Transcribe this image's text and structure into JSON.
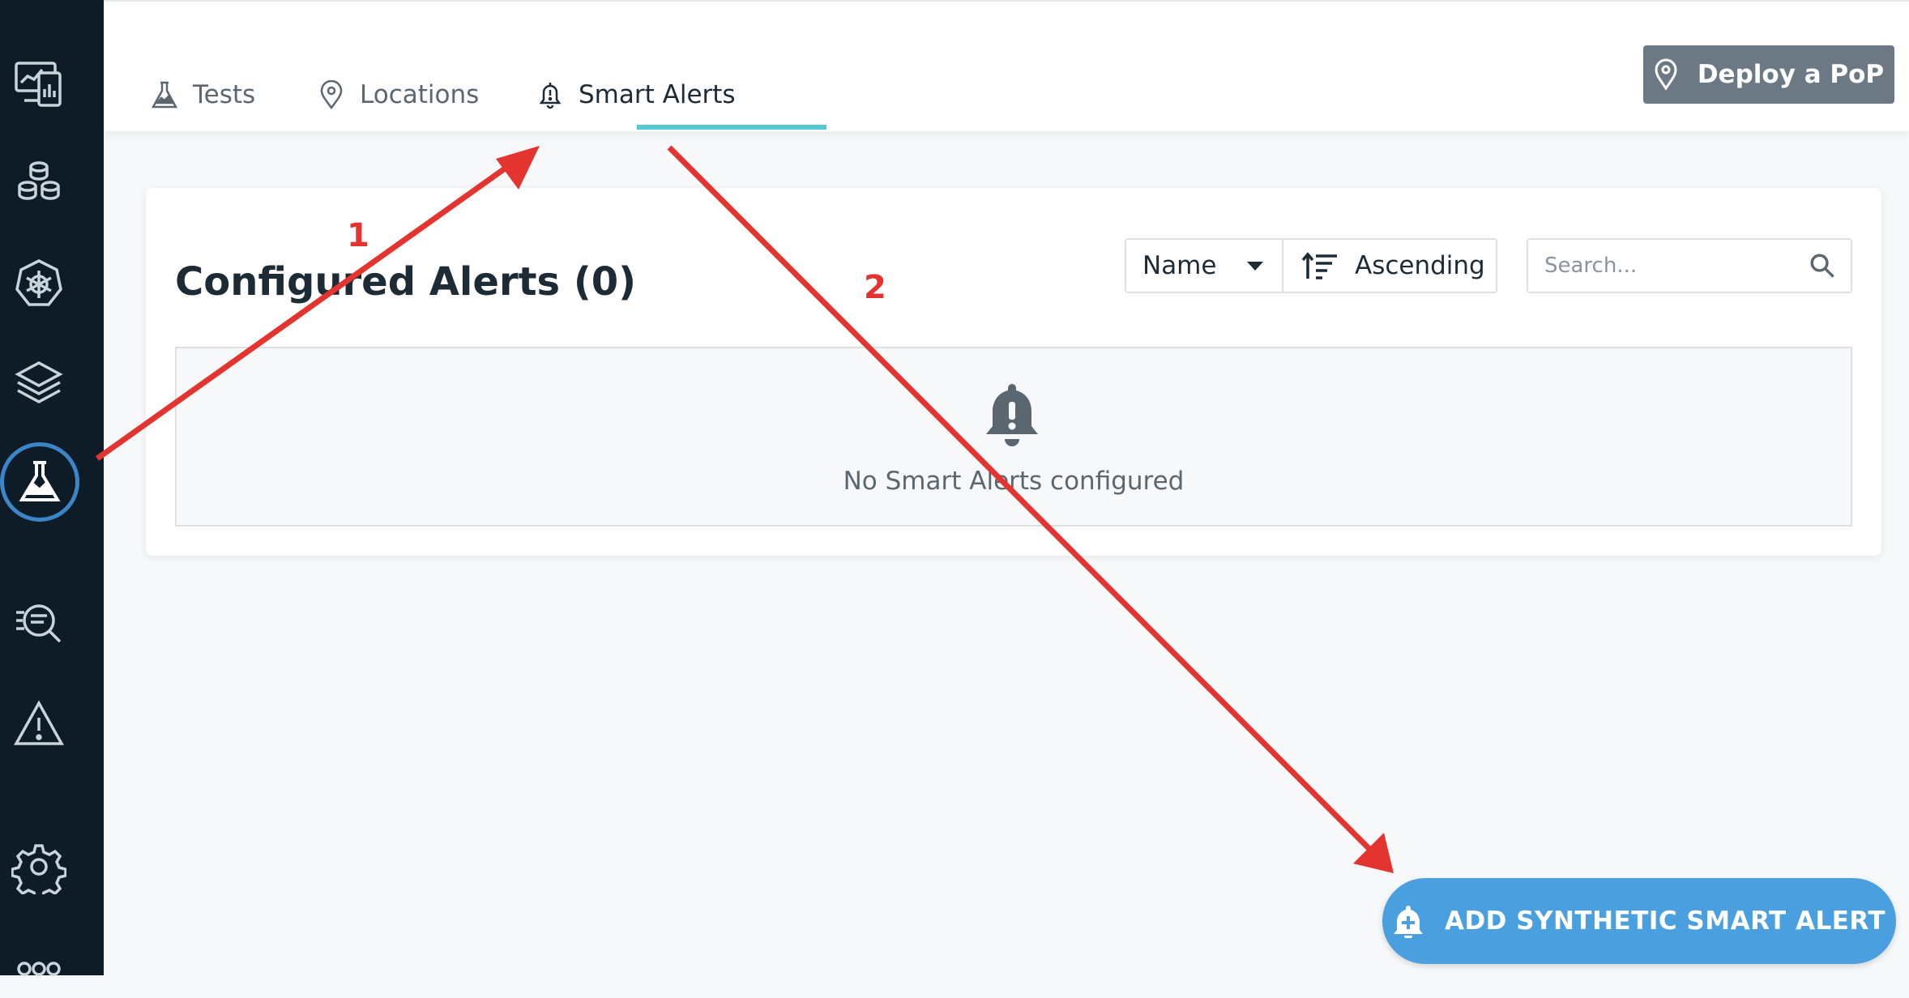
{
  "sidebar": {
    "items": [
      {
        "icon": "dashboard-monitor-icon"
      },
      {
        "icon": "infrastructure-cluster-icon"
      },
      {
        "icon": "kubernetes-icon"
      },
      {
        "icon": "stack-layers-icon"
      },
      {
        "icon": "synthetic-flask-icon",
        "active": true
      },
      {
        "icon": "analyze-search-icon"
      },
      {
        "icon": "events-warning-icon"
      },
      {
        "icon": "settings-gear-icon"
      },
      {
        "icon": "more-icon"
      }
    ]
  },
  "tabs": [
    {
      "label": "Tests",
      "icon": "flask-icon"
    },
    {
      "label": "Locations",
      "icon": "location-pin-icon"
    },
    {
      "label": "Smart Alerts",
      "icon": "bell-alert-icon",
      "active": true
    }
  ],
  "header": {
    "deploy_label": "Deploy a PoP"
  },
  "alerts": {
    "title": "Configured Alerts (0)",
    "sort_field": "Name",
    "sort_direction": "Ascending",
    "search_placeholder": "Search...",
    "empty_message": "No Smart Alerts configured"
  },
  "fab": {
    "label": "ADD SYNTHETIC SMART ALERT"
  },
  "annotations": [
    {
      "label": "1"
    },
    {
      "label": "2"
    }
  ],
  "colors": {
    "sidebar_bg": "#0e1c27",
    "active_ring": "#3a86c8",
    "tab_underline": "#56c8d3",
    "deploy_button": "#6c7984",
    "fab": "#4a9fdf",
    "annotation_red": "#e3342f"
  }
}
